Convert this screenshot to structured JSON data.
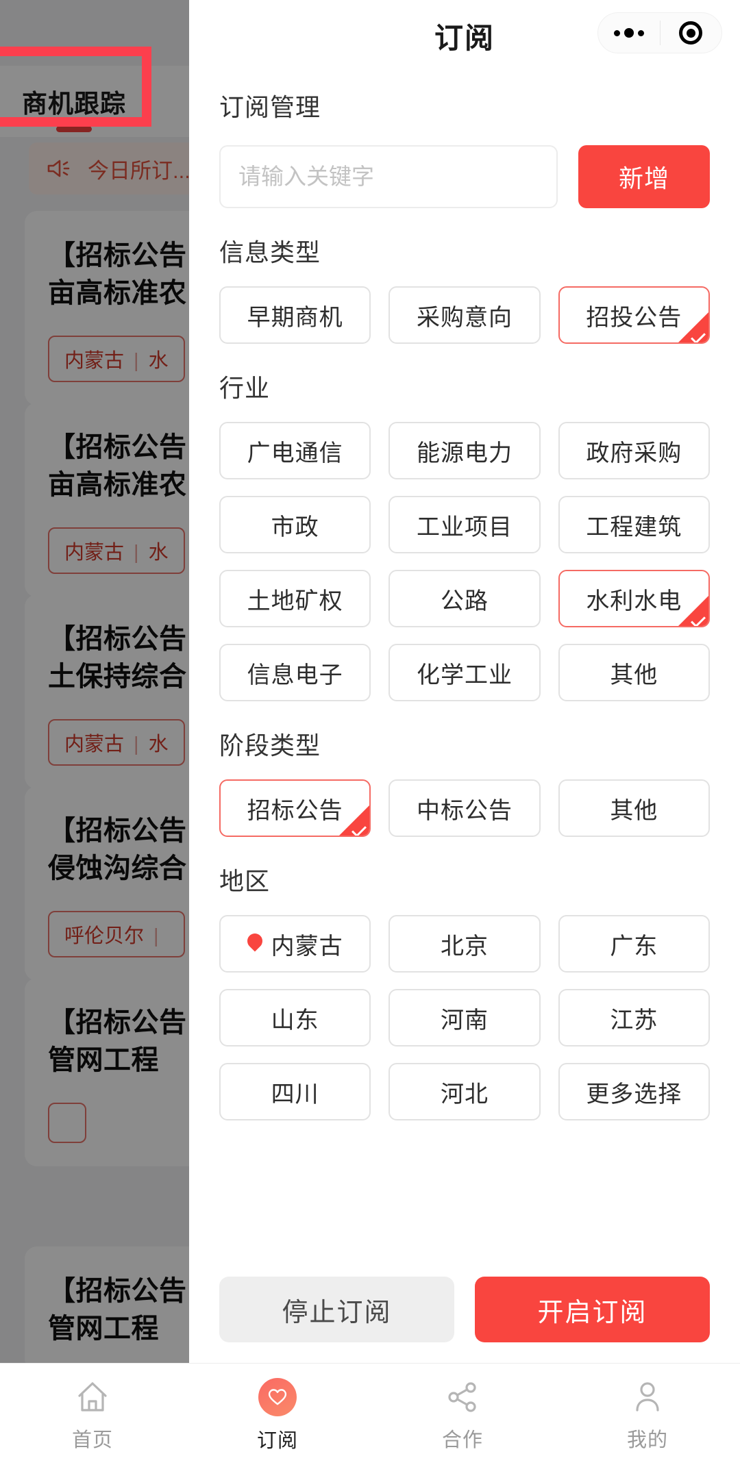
{
  "background": {
    "tab_label": "商机跟踪",
    "notice": {
      "icon": "speaker-icon",
      "text": "今日所订..."
    },
    "cards": [
      {
        "title_line1": "【招标公告",
        "title_line2": "亩高标准农",
        "tag_region": "内蒙古",
        "tag_industry": "水"
      },
      {
        "title_line1": "【招标公告",
        "title_line2": "亩高标准农",
        "tag_region": "内蒙古",
        "tag_industry": "水"
      },
      {
        "title_line1": "【招标公告",
        "title_line2": "土保持综合",
        "tag_region": "内蒙古",
        "tag_industry": "水"
      },
      {
        "title_line1": "【招标公告",
        "title_line2": "侵蚀沟综合",
        "tag_region": "呼伦贝尔",
        "tag_industry": ""
      },
      {
        "title_line1": "【招标公告",
        "title_line2": "管网工程",
        "tag_region": "",
        "tag_industry": ""
      }
    ]
  },
  "sheet": {
    "title": "订阅",
    "capsule": {
      "menu_icon": "more-dots-icon",
      "target_icon": "target-circle-icon"
    },
    "manage_section_title": "订阅管理",
    "search": {
      "placeholder": "请输入关键字",
      "value": ""
    },
    "add_button_label": "新增",
    "sections": [
      {
        "title": "信息类型",
        "chips": [
          {
            "label": "早期商机",
            "selected": false
          },
          {
            "label": "采购意向",
            "selected": false
          },
          {
            "label": "招投公告",
            "selected": true
          }
        ]
      },
      {
        "title": "行业",
        "chips": [
          {
            "label": "广电通信",
            "selected": false
          },
          {
            "label": "能源电力",
            "selected": false
          },
          {
            "label": "政府采购",
            "selected": false
          },
          {
            "label": "市政",
            "selected": false
          },
          {
            "label": "工业项目",
            "selected": false
          },
          {
            "label": "工程建筑",
            "selected": false
          },
          {
            "label": "土地矿权",
            "selected": false
          },
          {
            "label": "公路",
            "selected": false
          },
          {
            "label": "水利水电",
            "selected": true
          },
          {
            "label": "信息电子",
            "selected": false
          },
          {
            "label": "化学工业",
            "selected": false
          },
          {
            "label": "其他",
            "selected": false
          }
        ]
      },
      {
        "title": "阶段类型",
        "chips": [
          {
            "label": "招标公告",
            "selected": true
          },
          {
            "label": "中标公告",
            "selected": false
          },
          {
            "label": "其他",
            "selected": false
          }
        ]
      },
      {
        "title": "地区",
        "chips": [
          {
            "label": "内蒙古",
            "selected": false,
            "icon": "location-pin-icon"
          },
          {
            "label": "北京",
            "selected": false
          },
          {
            "label": "广东",
            "selected": false
          },
          {
            "label": "山东",
            "selected": false
          },
          {
            "label": "河南",
            "selected": false
          },
          {
            "label": "江苏",
            "selected": false
          },
          {
            "label": "四川",
            "selected": false
          },
          {
            "label": "河北",
            "selected": false
          },
          {
            "label": "更多选择",
            "selected": false
          }
        ]
      }
    ],
    "footer": {
      "stop_label": "停止订阅",
      "start_label": "开启订阅"
    }
  },
  "tabbar": {
    "items": [
      {
        "label": "首页",
        "icon": "home-icon",
        "active": false
      },
      {
        "label": "订阅",
        "icon": "heart-icon",
        "active": true
      },
      {
        "label": "合作",
        "icon": "share-icon",
        "active": false
      },
      {
        "label": "我的",
        "icon": "person-icon",
        "active": false
      }
    ]
  },
  "colors": {
    "accent": "#f9453f",
    "annotation": "#fc3f4d",
    "chip_selected_border": "#f56a63",
    "muted_text": "#9a9a9a"
  }
}
